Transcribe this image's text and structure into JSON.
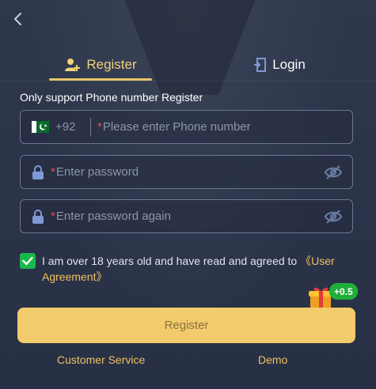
{
  "header": {
    "back_icon": "chevron-left-icon"
  },
  "tabs": {
    "register_label": "Register",
    "register_icon": "add-user-icon",
    "login_label": "Login",
    "login_icon": "login-door-icon",
    "active": "register"
  },
  "form": {
    "hint": "Only support Phone number Register",
    "phone": {
      "country_code": "+92",
      "flag_icon": "pakistan-flag-icon",
      "required_mark": "*",
      "placeholder": "Please enter Phone number",
      "value": ""
    },
    "password": {
      "required_mark": "*",
      "placeholder": "Enter password",
      "value": "",
      "icon": "lock-icon",
      "toggle_icon": "eye-off-icon"
    },
    "password_again": {
      "required_mark": "*",
      "placeholder": "Enter password again",
      "value": "",
      "icon": "lock-icon",
      "toggle_icon": "eye-off-icon"
    },
    "agreement": {
      "checked": true,
      "text": "I am over 18 years old and have read and agreed to ",
      "link": "《User Agreement》"
    },
    "bonus": {
      "label": "+0.5",
      "icon": "gift-icon"
    },
    "submit_label": "Register"
  },
  "footer": {
    "customer_service": "Customer Service",
    "demo": "Demo"
  },
  "colors": {
    "accent": "#f2cb6d",
    "background": "#2a3248",
    "check_green": "#19b84a",
    "required_red": "#e05252"
  }
}
